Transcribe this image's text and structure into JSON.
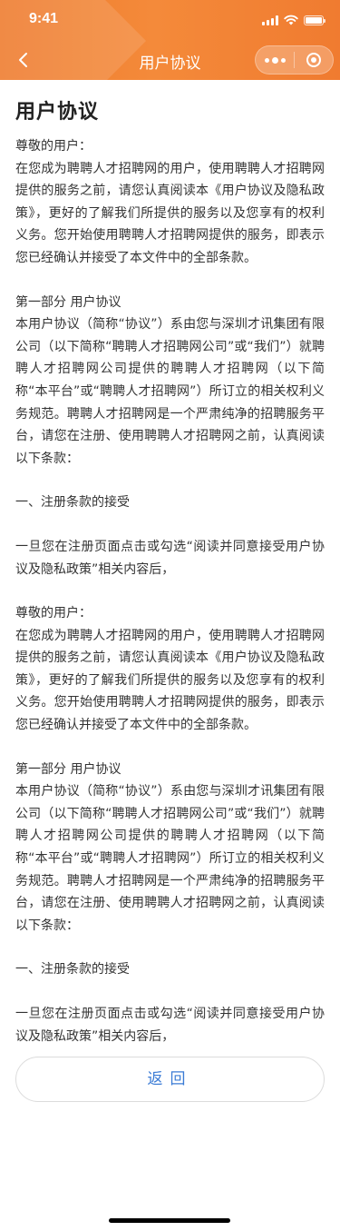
{
  "status_bar": {
    "time": "9:41"
  },
  "nav": {
    "title": "用户协议"
  },
  "page": {
    "title": "用户协议"
  },
  "sections": [
    {
      "greeting": "尊敬的用户：",
      "intro": "在您成为聘聘人才招聘网的用户，使用聘聘人才招聘网提供的服务之前，请您认真阅读本《用户协议及隐私政策》，更好的了解我们所提供的服务以及您享有的权利义务。您开始使用聘聘人才招聘网提供的服务，即表示您已经确认并接受了本文件中的全部条款。",
      "part_title": "第一部分 用户协议",
      "part_body": "本用户协议（简称“协议”）系由您与深圳才讯集团有限公司（以下简称“聘聘人才招聘网公司”或“我们”）就聘聘人才招聘网公司提供的聘聘人才招聘网（以下简称“本平台”或“聘聘人才招聘网”）所订立的相关权利义务规范。聘聘人才招聘网是一个严肃纯净的招聘服务平台，请您在注册、使用聘聘人才招聘网之前，认真阅读以下条款：",
      "clause_title": "一、注册条款的接受",
      "clause_body": "一旦您在注册页面点击或勾选“阅读并同意接受用户协议及隐私政策”相关内容后，"
    },
    {
      "greeting": "尊敬的用户：",
      "intro": "在您成为聘聘人才招聘网的用户，使用聘聘人才招聘网提供的服务之前，请您认真阅读本《用户协议及隐私政策》，更好的了解我们所提供的服务以及您享有的权利义务。您开始使用聘聘人才招聘网提供的服务，即表示您已经确认并接受了本文件中的全部条款。",
      "part_title": "第一部分 用户协议",
      "part_body": "本用户协议（简称“协议”）系由您与深圳才讯集团有限公司（以下简称“聘聘人才招聘网公司”或“我们”）就聘聘人才招聘网公司提供的聘聘人才招聘网（以下简称“本平台”或“聘聘人才招聘网”）所订立的相关权利义务规范。聘聘人才招聘网是一个严肃纯净的招聘服务平台，请您在注册、使用聘聘人才招聘网之前，认真阅读以下条款：",
      "clause_title": "一、注册条款的接受",
      "clause_body": "一旦您在注册页面点击或勾选“阅读并同意接受用户协议及隐私政策”相关内容后，"
    }
  ],
  "actions": {
    "back_label": "返回"
  },
  "icons": {
    "back": "chevron-left-icon",
    "more": "more-dots-icon",
    "close": "close-circle-icon"
  },
  "colors": {
    "header": "#f07f31",
    "button_text": "#3a7bd5"
  }
}
